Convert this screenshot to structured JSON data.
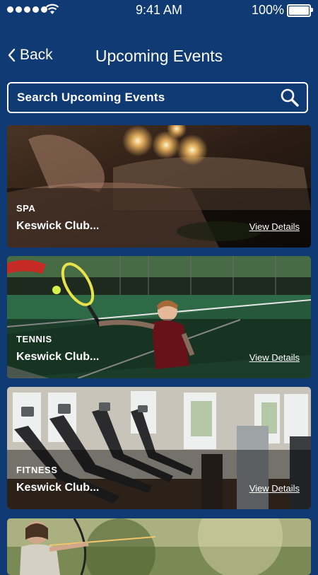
{
  "status_bar": {
    "time": "9:41 AM",
    "battery": "100%"
  },
  "nav": {
    "back_label": "Back",
    "title": "Upcoming Events"
  },
  "search": {
    "placeholder": "Search Upcoming Events"
  },
  "events": [
    {
      "category": "SPA",
      "name": "Keswick Club...",
      "details_label": "View Details"
    },
    {
      "category": "TENNIS",
      "name": "Keswick Club...",
      "details_label": "View Details"
    },
    {
      "category": "FITNESS",
      "name": "Keswick Club...",
      "details_label": "View Details"
    }
  ],
  "colors": {
    "background": "#0f3a73",
    "accent": "#ffffff"
  },
  "icons": [
    "signal-dots",
    "wifi-icon",
    "battery-icon",
    "chevron-left-icon",
    "search-icon"
  ]
}
